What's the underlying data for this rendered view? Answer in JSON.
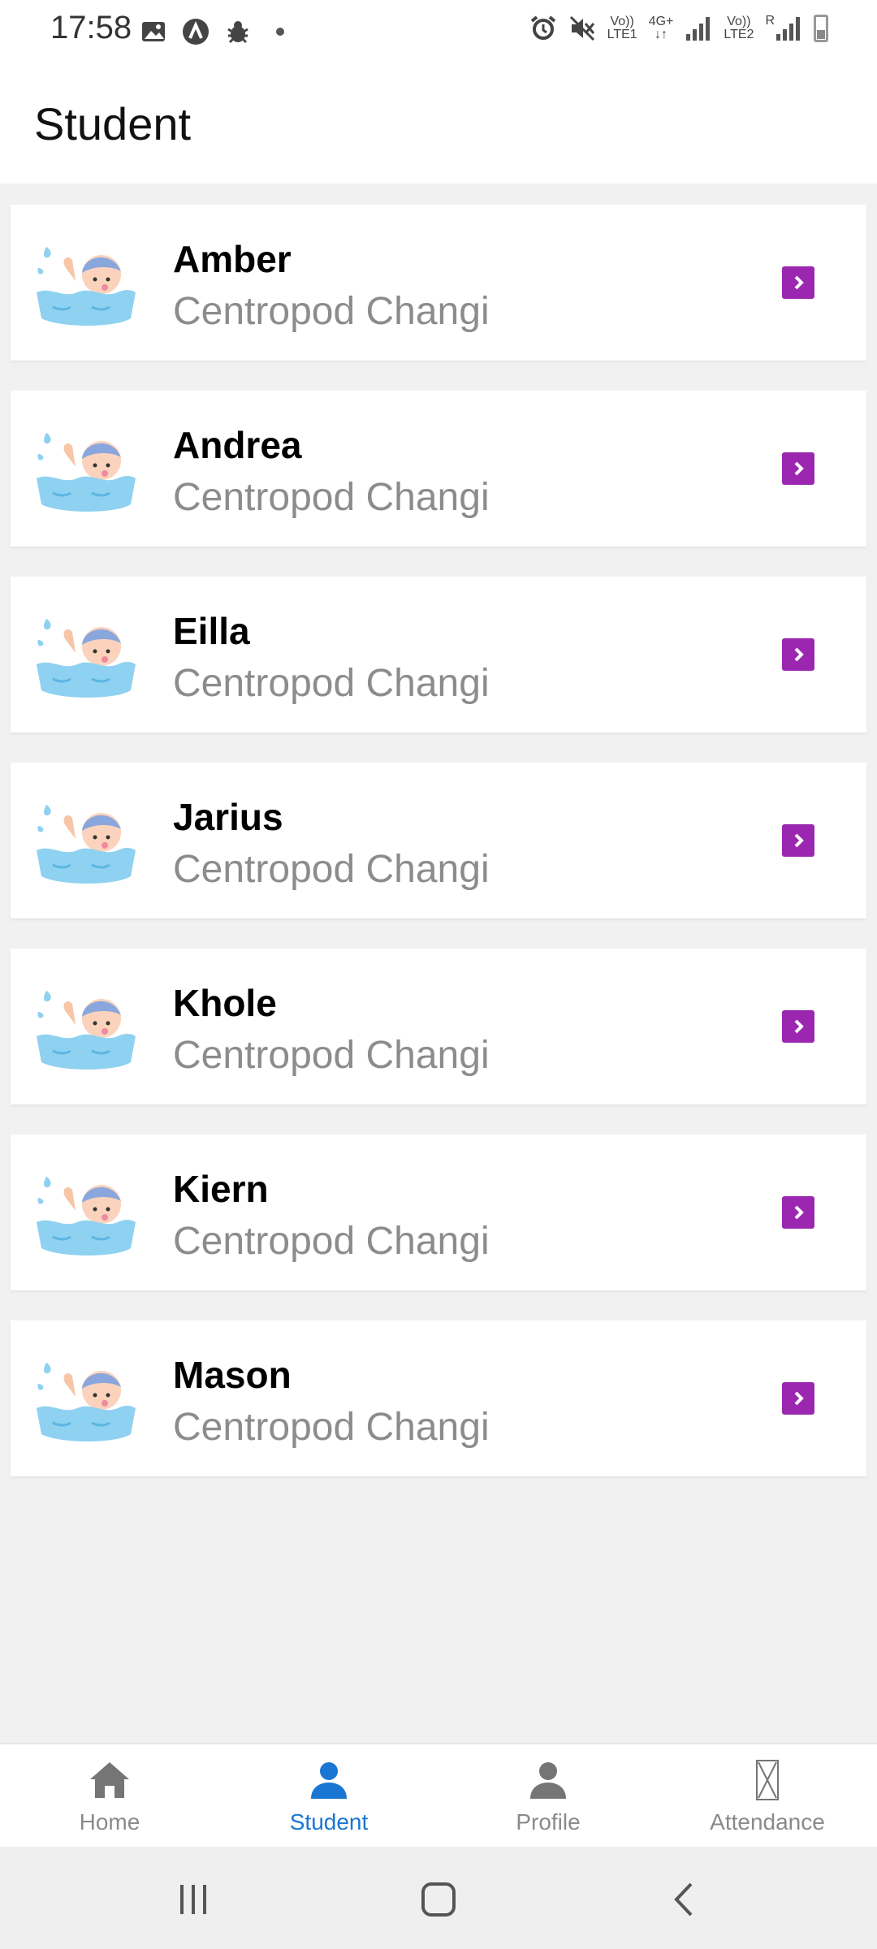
{
  "status_bar": {
    "time": "17:58",
    "sim1_label_top": "Vo))",
    "sim1_label_bottom": "LTE1",
    "network_label_top": "4G+",
    "sim2_label_top": "Vo))",
    "sim2_label_bottom": "LTE2",
    "roaming_label": "R"
  },
  "header": {
    "title": "Student"
  },
  "students": [
    {
      "name": "Amber",
      "location": "Centropod Changi"
    },
    {
      "name": "Andrea",
      "location": "Centropod Changi"
    },
    {
      "name": "Eilla",
      "location": "Centropod Changi"
    },
    {
      "name": "Jarius",
      "location": "Centropod Changi"
    },
    {
      "name": "Khole",
      "location": "Centropod Changi"
    },
    {
      "name": "Kiern",
      "location": "Centropod Changi"
    },
    {
      "name": "Mason",
      "location": "Centropod Changi"
    }
  ],
  "bottom_nav": {
    "items": [
      {
        "label": "Home",
        "icon": "home-icon",
        "active": false
      },
      {
        "label": "Student",
        "icon": "person-icon",
        "active": true
      },
      {
        "label": "Profile",
        "icon": "profile-icon",
        "active": false
      },
      {
        "label": "Attendance",
        "icon": "hourglass-icon",
        "active": false
      }
    ]
  },
  "colors": {
    "accent_purple": "#9b27b0",
    "active_blue": "#1976d2",
    "inactive_gray": "#8a8a8a",
    "background": "#f1f1f1"
  }
}
